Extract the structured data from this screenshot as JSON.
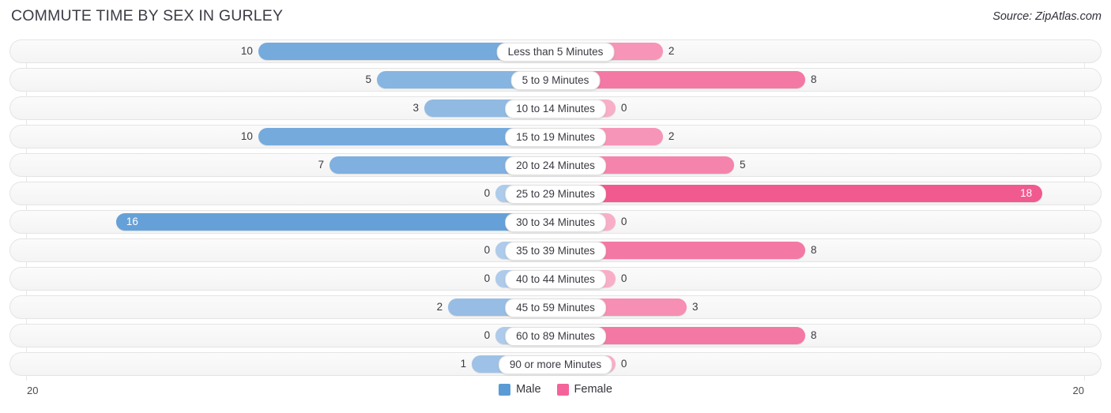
{
  "header": {
    "title": "COMMUTE TIME BY SEX IN GURLEY",
    "source": "Source: ZipAtlas.com"
  },
  "axis": {
    "left_max_label": "20",
    "right_max_label": "20"
  },
  "legend": {
    "items": [
      {
        "label": "Male",
        "color": "#5b9bd5",
        "icon": "square-swatch"
      },
      {
        "label": "Female",
        "color": "#f4649a",
        "icon": "square-swatch"
      }
    ]
  },
  "chart_data": {
    "type": "bar",
    "subtype": "diverging-bar",
    "title": "COMMUTE TIME BY SEX IN GURLEY",
    "xlabel": "",
    "ylabel": "",
    "xlim": [
      0,
      20
    ],
    "grid": true,
    "legend_position": "bottom-center",
    "categories": [
      "Less than 5 Minutes",
      "5 to 9 Minutes",
      "10 to 14 Minutes",
      "15 to 19 Minutes",
      "20 to 24 Minutes",
      "25 to 29 Minutes",
      "30 to 34 Minutes",
      "35 to 39 Minutes",
      "40 to 44 Minutes",
      "45 to 59 Minutes",
      "60 to 89 Minutes",
      "90 or more Minutes"
    ],
    "series": [
      {
        "name": "Male",
        "side": "left",
        "color": "#5b9bd5",
        "values": [
          10,
          5,
          3,
          10,
          7,
          0,
          16,
          0,
          0,
          2,
          0,
          1
        ],
        "labels": [
          "10",
          "5",
          "3",
          "10",
          "7",
          "0",
          "16",
          "0",
          "0",
          "2",
          "0",
          "1"
        ]
      },
      {
        "name": "Female",
        "side": "right",
        "color": "#f4649a",
        "values": [
          2,
          8,
          0,
          2,
          5,
          18,
          0,
          8,
          0,
          3,
          8,
          0
        ],
        "labels": [
          "2",
          "8",
          "0",
          "2",
          "5",
          "18",
          "0",
          "8",
          "0",
          "3",
          "8",
          "0"
        ]
      }
    ]
  }
}
